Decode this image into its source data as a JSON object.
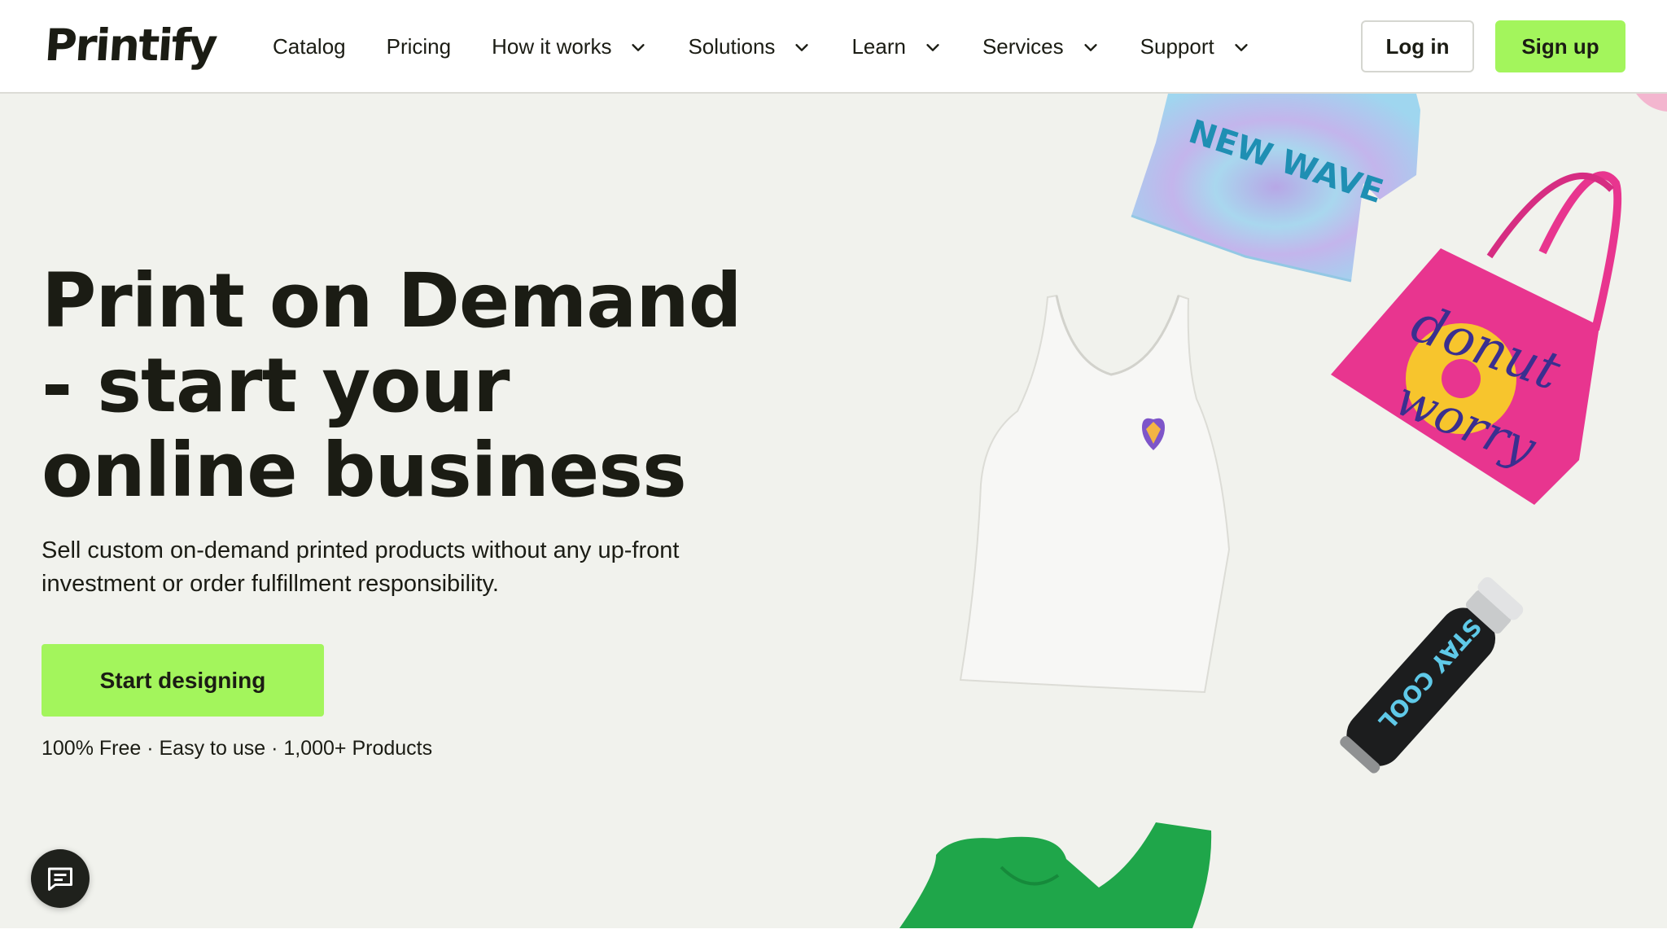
{
  "nav": {
    "logo": "Printify",
    "items": [
      {
        "label": "Catalog",
        "dropdown": false
      },
      {
        "label": "Pricing",
        "dropdown": false
      },
      {
        "label": "How it works",
        "dropdown": true
      },
      {
        "label": "Solutions",
        "dropdown": true
      },
      {
        "label": "Learn",
        "dropdown": true
      },
      {
        "label": "Services",
        "dropdown": true
      },
      {
        "label": "Support",
        "dropdown": true
      }
    ],
    "login_label": "Log in",
    "signup_label": "Sign up"
  },
  "hero": {
    "title": "Print on Demand - start your online business",
    "subtitle": "Sell custom on-demand printed products without any up-front investment or order fulfillment responsibility.",
    "cta_label": "Start designing",
    "perks": "100% Free · Easy to use · 1,000+ Products"
  },
  "products": {
    "tshirt_text": "NEW WAVE",
    "tote_text_1": "donut",
    "tote_text_2": "worry",
    "bottle_text": "STAY COOL"
  },
  "colors": {
    "accent": "#a3f55c",
    "background": "#f1f2ed",
    "text": "#1b1c14",
    "tote": "#e8358f",
    "hoodie": "#1fa64a"
  },
  "icons": {
    "chevron": "chevron-down-icon",
    "chat": "chat-icon"
  }
}
